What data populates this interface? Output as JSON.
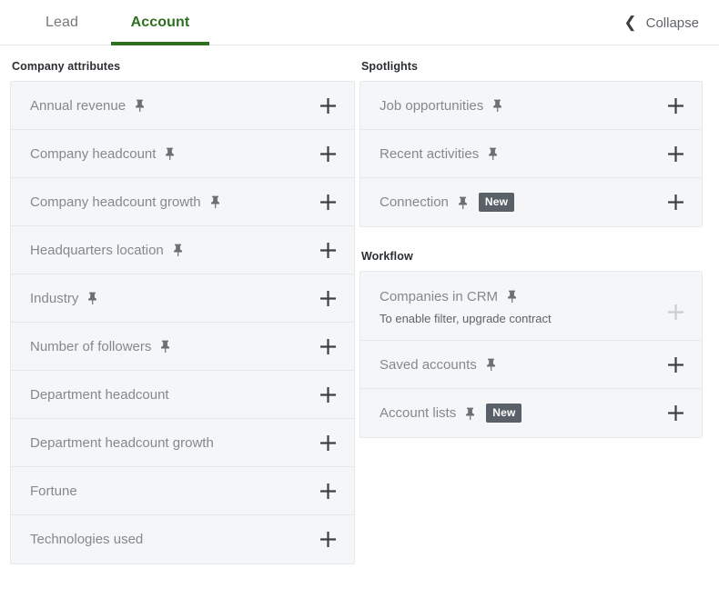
{
  "header": {
    "tabs": [
      {
        "label": "Lead",
        "active": false
      },
      {
        "label": "Account",
        "active": true
      }
    ],
    "collapse": {
      "label": "Collapse",
      "icon": "chevron-left-icon",
      "glyph": "❮"
    }
  },
  "colors": {
    "accent_green": "#2e6f21",
    "card_bg": "#f4f6f8",
    "card_border": "#e6e9ec",
    "label_text": "#84898e",
    "badge_bg": "#5a6067",
    "plus_enabled": "#3d4145",
    "plus_disabled": "#c9cdd1"
  },
  "sections": [
    {
      "id": "company-attributes",
      "column": "left",
      "title": "Company attributes",
      "items": [
        {
          "label": "Annual revenue",
          "pinned": true,
          "badge": null,
          "sub": null,
          "add_enabled": true
        },
        {
          "label": "Company headcount",
          "pinned": true,
          "badge": null,
          "sub": null,
          "add_enabled": true
        },
        {
          "label": "Company headcount growth",
          "pinned": true,
          "badge": null,
          "sub": null,
          "add_enabled": true
        },
        {
          "label": "Headquarters location",
          "pinned": true,
          "badge": null,
          "sub": null,
          "add_enabled": true
        },
        {
          "label": "Industry",
          "pinned": true,
          "badge": null,
          "sub": null,
          "add_enabled": true
        },
        {
          "label": "Number of followers",
          "pinned": true,
          "badge": null,
          "sub": null,
          "add_enabled": true
        },
        {
          "label": "Department headcount",
          "pinned": false,
          "badge": null,
          "sub": null,
          "add_enabled": true
        },
        {
          "label": "Department headcount growth",
          "pinned": false,
          "badge": null,
          "sub": null,
          "add_enabled": true
        },
        {
          "label": "Fortune",
          "pinned": false,
          "badge": null,
          "sub": null,
          "add_enabled": true
        },
        {
          "label": "Technologies used",
          "pinned": false,
          "badge": null,
          "sub": null,
          "add_enabled": true
        }
      ]
    },
    {
      "id": "spotlights",
      "column": "right",
      "title": "Spotlights",
      "items": [
        {
          "label": "Job opportunities",
          "pinned": true,
          "badge": null,
          "sub": null,
          "add_enabled": true
        },
        {
          "label": "Recent activities",
          "pinned": true,
          "badge": null,
          "sub": null,
          "add_enabled": true
        },
        {
          "label": "Connection",
          "pinned": true,
          "badge": "New",
          "sub": null,
          "add_enabled": true
        }
      ]
    },
    {
      "id": "workflow",
      "column": "right",
      "title": "Workflow",
      "items": [
        {
          "label": "Companies in CRM",
          "pinned": true,
          "badge": null,
          "sub": "To enable filter, upgrade contract",
          "add_enabled": false
        },
        {
          "label": "Saved accounts",
          "pinned": true,
          "badge": null,
          "sub": null,
          "add_enabled": true
        },
        {
          "label": "Account lists",
          "pinned": true,
          "badge": "New",
          "sub": null,
          "add_enabled": true
        }
      ]
    }
  ],
  "icons": {
    "pin": "pin-icon",
    "plus": "plus-icon"
  }
}
